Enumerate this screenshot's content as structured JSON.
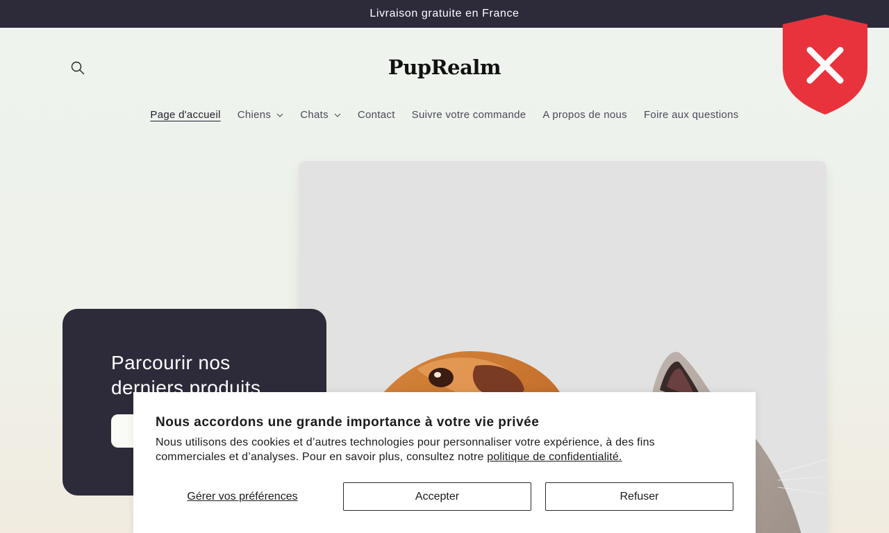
{
  "announcement": {
    "text": "Livraison gratuite en France"
  },
  "header": {
    "logo": "PupRealm",
    "search_icon": "search-icon"
  },
  "nav": {
    "items": [
      {
        "label": "Page d'accueil",
        "active": true,
        "dropdown": false
      },
      {
        "label": "Chiens",
        "active": false,
        "dropdown": true
      },
      {
        "label": "Chats",
        "active": false,
        "dropdown": true
      },
      {
        "label": "Contact",
        "active": false,
        "dropdown": false
      },
      {
        "label": "Suivre votre commande",
        "active": false,
        "dropdown": false
      },
      {
        "label": "A propos de nous",
        "active": false,
        "dropdown": false
      },
      {
        "label": "Foire aux questions",
        "active": false,
        "dropdown": false
      }
    ]
  },
  "hero": {
    "title": "Parcourir nos derniers produits",
    "image": "dog-and-cat-photo"
  },
  "cookie_banner": {
    "title": "Nous accordons une grande importance à votre vie privée",
    "text_line1": "Nous utilisons des cookies et d’autres technologies pour personnaliser votre expérience, à des fins",
    "text_line2_prefix": "commerciales et d’analyses. Pour en savoir plus, consultez notre ",
    "policy_link": "politique de confidentialité.",
    "preferences_label": "Gérer vos préférences",
    "accept_label": "Accepter",
    "refuse_label": "Refuser"
  },
  "overlay_badge": {
    "icon": "shield-x-icon",
    "color": "#e8333d"
  },
  "colors": {
    "dark": "#2d2b3a",
    "accent_red": "#e8333d"
  }
}
